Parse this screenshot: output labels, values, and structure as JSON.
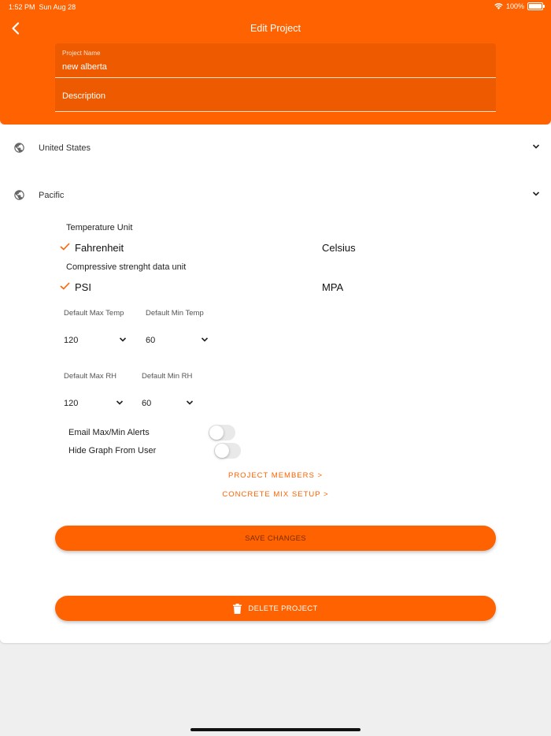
{
  "status_bar": {
    "time": "1:52 PM",
    "date": "Sun Aug 28",
    "battery": "100%"
  },
  "header": {
    "title": "Edit Project",
    "back_icon": "chevron-left-icon",
    "project_name": {
      "label": "Project Name",
      "value": "new alberta"
    },
    "description": {
      "placeholder": "Description"
    }
  },
  "location": {
    "country": "United States",
    "timezone": "Pacific"
  },
  "units": {
    "temperature_heading": "Temperature Unit",
    "temperature_options": [
      "Fahrenheit",
      "Celsius"
    ],
    "temperature_selected": "Fahrenheit",
    "strength_heading": "Compressive strenght data unit",
    "strength_options": [
      "PSI",
      "MPA"
    ],
    "strength_selected": "PSI"
  },
  "defaults": {
    "max_temp": {
      "label": "Default Max Temp",
      "value": "120"
    },
    "min_temp": {
      "label": "Default Min Temp",
      "value": "60"
    },
    "max_rh": {
      "label": "Default Max RH",
      "value": "120"
    },
    "min_rh": {
      "label": "Default Min RH",
      "value": "60"
    }
  },
  "toggles": {
    "email_alerts": {
      "label": "Email Max/Min Alerts",
      "on": false
    },
    "hide_graph": {
      "label": "Hide Graph From User",
      "on": false
    }
  },
  "links": {
    "project_members": "PROJECT MEMBERS >",
    "concrete_mix": "CONCRETE MIX SETUP >"
  },
  "buttons": {
    "save": "SAVE CHANGES",
    "delete": "DELETE PROJECT"
  },
  "colors": {
    "accent": "#ff6200",
    "field_bg": "#ee5a00",
    "card_bg": "#ffffff",
    "page_bg": "#efefef"
  }
}
